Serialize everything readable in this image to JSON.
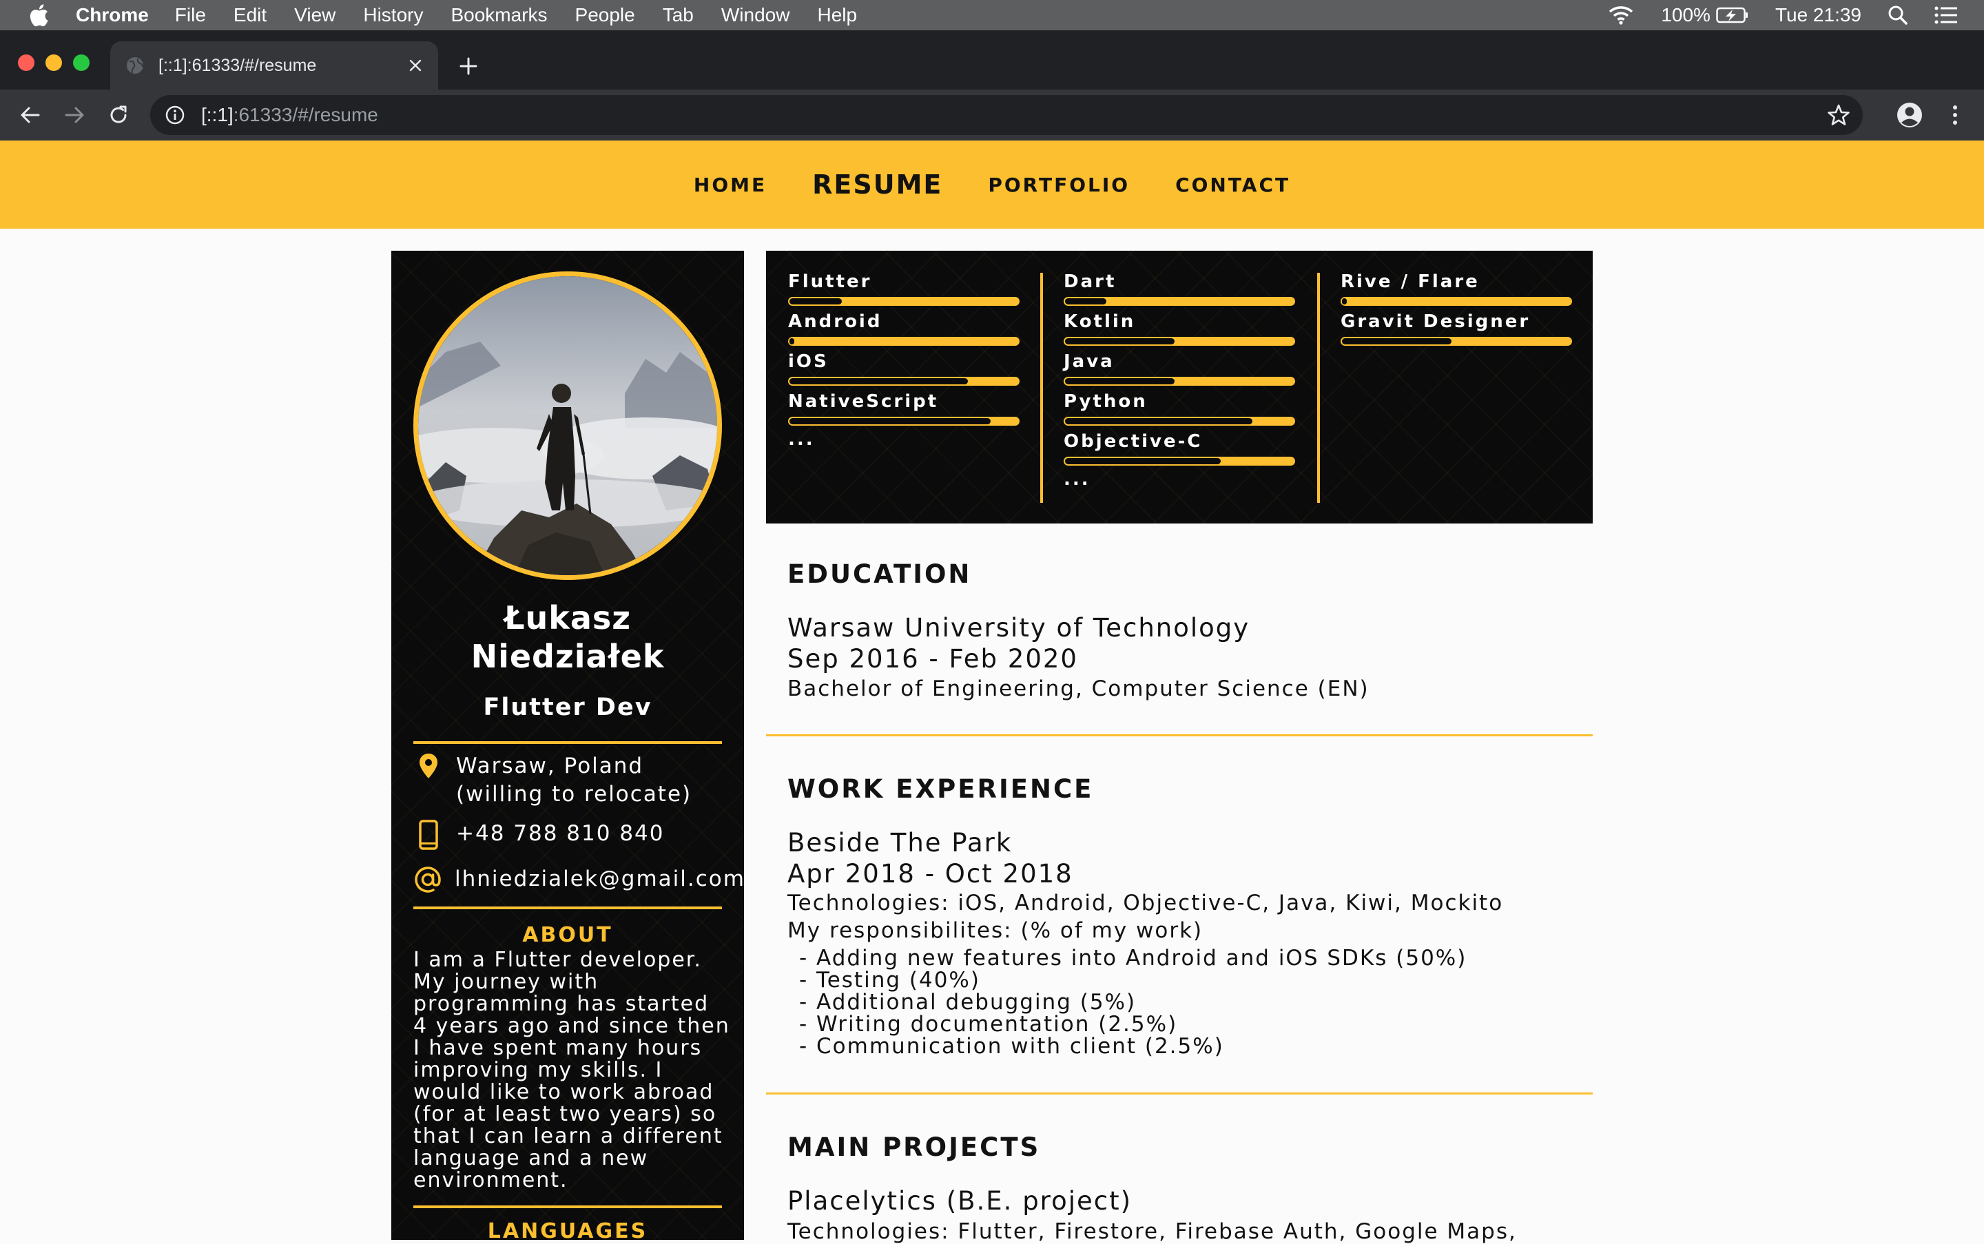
{
  "menubar": {
    "app": "Chrome",
    "items": [
      "File",
      "Edit",
      "View",
      "History",
      "Bookmarks",
      "People",
      "Tab",
      "Window",
      "Help"
    ],
    "battery": "100%",
    "clock": "Tue 21:39"
  },
  "browser": {
    "tab_title": "[::1]:61333/#/resume",
    "url_host": "[::1]",
    "url_rest": ":61333/#/resume"
  },
  "nav": {
    "home": "HOME",
    "resume": "RESUME",
    "portfolio": "PORTFOLIO",
    "contact": "CONTACT"
  },
  "profile": {
    "name_line1": "Łukasz",
    "name_line2": "Niedziałek",
    "role": "Flutter Dev",
    "location": "Warsaw, Poland\n(willing to relocate)",
    "phone": "+48 788 810 840",
    "email": "lhniedzialek@gmail.com",
    "about_heading": "ABOUT",
    "about_text": "I am a Flutter developer. My journey with programming has started 4 years ago and since then I have spent many hours improving my skills. I would like to work abroad (for at least two years) so that I can learn a different language and a new environment.",
    "languages_heading": "LANGUAGES"
  },
  "skills": {
    "columns": [
      {
        "items": [
          {
            "label": "Flutter",
            "level": 0.23
          },
          {
            "label": "Android",
            "level": 0.02
          },
          {
            "label": "iOS",
            "level": 0.78
          },
          {
            "label": "NativeScript",
            "level": 0.88
          }
        ],
        "more": "..."
      },
      {
        "items": [
          {
            "label": "Dart",
            "level": 0.18
          },
          {
            "label": "Kotlin",
            "level": 0.48
          },
          {
            "label": "Java",
            "level": 0.48
          },
          {
            "label": "Python",
            "level": 0.82
          },
          {
            "label": "Objective-C",
            "level": 0.68
          }
        ],
        "more": "..."
      },
      {
        "items": [
          {
            "label": "Rive / Flare",
            "level": 0.02
          },
          {
            "label": "Gravit Designer",
            "level": 0.48
          }
        ],
        "more": ""
      }
    ]
  },
  "education": {
    "heading": "EDUCATION",
    "school": "Warsaw University of Technology",
    "dates": "Sep 2016 - Feb 2020",
    "degree": "Bachelor of Engineering, Computer Science (EN)"
  },
  "work": {
    "heading": "WORK EXPERIENCE",
    "company": "Beside The Park",
    "dates": "Apr 2018 - Oct 2018",
    "technologies": "Technologies: iOS, Android, Objective-C, Java, Kiwi, Mockito",
    "resp_intro": "My responsibilites: (% of my work)",
    "responsibilities": [
      "- Adding new features into Android and iOS SDKs (50%)",
      "- Testing (40%)",
      "- Additional debugging (5%)",
      "- Writing documentation (2.5%)",
      "- Communication with client (2.5%)"
    ]
  },
  "projects": {
    "heading": "MAIN PROJECTS",
    "title": "Placelytics (B.E. project)",
    "technologies": "Technologies: Flutter, Firestore, Firebase Auth, Google Maps,"
  },
  "colors": {
    "accent": "#fbbf2f",
    "dark": "#0b0b0c",
    "page": "#fbfbfb"
  }
}
